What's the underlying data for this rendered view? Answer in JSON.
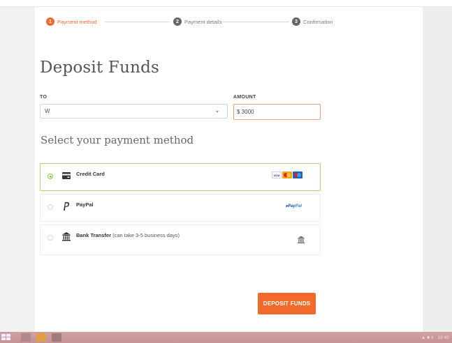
{
  "stepper": {
    "steps": [
      {
        "num": "1",
        "label": "Payment method",
        "state": "active"
      },
      {
        "num": "2",
        "label": "Payment details",
        "state": "inactive"
      },
      {
        "num": "3",
        "label": "Confirmation",
        "state": "inactive"
      }
    ]
  },
  "colors": {
    "accent": "#f26a2b",
    "selected": "#8cc63f",
    "step_inactive": "#666666"
  },
  "title": "Deposit Funds",
  "to": {
    "label": "TO",
    "value": "W"
  },
  "amount": {
    "label": "AMOUNT",
    "value": "$ 3000"
  },
  "section_title": "Select your payment method",
  "methods": [
    {
      "label": "Credit Card",
      "icon": "credit-card-icon",
      "selected": true,
      "brands": [
        "VISA",
        "MasterCard",
        "Maestro"
      ]
    },
    {
      "label": "PayPal",
      "icon": "paypal-icon",
      "selected": false,
      "brand_text_a": "Pay",
      "brand_text_b": "Pal"
    },
    {
      "label": "Bank Transfer",
      "note": " (can take 3-5 business days)",
      "icon": "bank-icon",
      "selected": false
    }
  ],
  "deposit_button": "DEPOSIT FUNDS",
  "taskbar": {
    "tray_text": "▲ ■ ३   10:40"
  }
}
